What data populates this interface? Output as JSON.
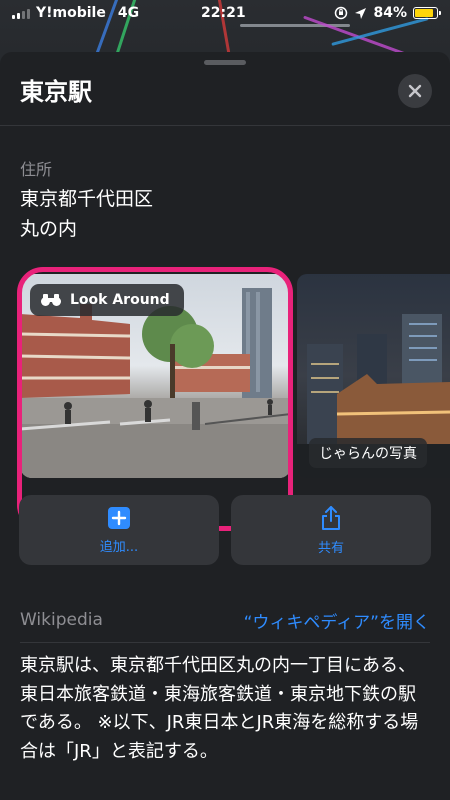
{
  "status_bar": {
    "carrier": "Y!mobile",
    "network": "4G",
    "time": "22:21",
    "battery_percent": "84%",
    "battery_level": 0.84,
    "battery_color": "#ffd60a"
  },
  "sheet": {
    "title": "東京駅",
    "close_icon": "close-icon"
  },
  "address": {
    "label": "住所",
    "line1": "東京都千代田区",
    "line2": "丸の内"
  },
  "photos": {
    "look_around_label": "Look Around",
    "jalan_label": "じゃらんの写真",
    "highlight_color": "#e8227a"
  },
  "actions": {
    "add_label": "追加...",
    "share_label": "共有",
    "accent": "#2f8cff"
  },
  "wikipedia": {
    "label": "Wikipedia",
    "open_link": "“ウィキペディア”を開く",
    "text": "東京駅は、東京都千代田区丸の内一丁目にある、東日本旅客鉄道・東海旅客鉄道・東京地下鉄の駅である。 ※以下、JR東日本とJR東海を総称する場合は「JR」と表記する。"
  }
}
